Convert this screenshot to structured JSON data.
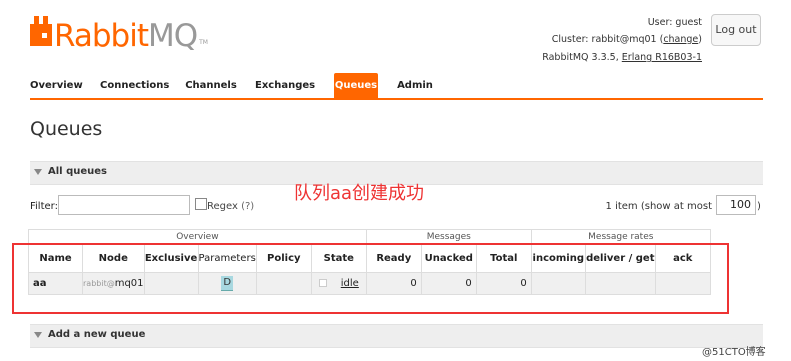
{
  "header": {
    "logo_left": "Rabbit",
    "logo_right": "MQ",
    "logo_tm": "TM",
    "user_label": "User:",
    "user_value": "guest",
    "cluster_label": "Cluster:",
    "cluster_value": "rabbit@mq01",
    "change_link": "change",
    "version_text": "RabbitMQ 3.3.5,",
    "erlang_text": "Erlang R16B03-1",
    "logout_label": "Log out"
  },
  "tabs": [
    {
      "label": "Overview",
      "active": false
    },
    {
      "label": "Connections",
      "active": false
    },
    {
      "label": "Channels",
      "active": false
    },
    {
      "label": "Exchanges",
      "active": false
    },
    {
      "label": "Queues",
      "active": true
    },
    {
      "label": "Admin",
      "active": false
    }
  ],
  "page_title": "Queues",
  "all_queues": {
    "section_label": "All queues",
    "filter_label": "Filter:",
    "filter_value": "",
    "regex_label": "Regex",
    "regex_help": "(?)",
    "items_text": "1 item (show at most",
    "max_value": "100",
    "max_close": ")",
    "annotation_cn": "队列aa创建成功",
    "group_headers": {
      "overview": "Overview",
      "messages": "Messages",
      "message_rates": "Message rates"
    },
    "columns": {
      "name": "Name",
      "node": "Node",
      "exclusive": "Exclusive",
      "parameters": "Parameters",
      "policy": "Policy",
      "state": "State",
      "ready": "Ready",
      "unacked": "Unacked",
      "total": "Total",
      "incoming": "incoming",
      "deliver_get": "deliver / get",
      "ack": "ack"
    },
    "rows": [
      {
        "name": "aa",
        "node_prefix": "rabbit@",
        "node_host": "mq01",
        "exclusive": "",
        "parameters": "D",
        "policy": "",
        "state": "idle",
        "ready": "0",
        "unacked": "0",
        "total": "0",
        "incoming": "",
        "deliver_get": "",
        "ack": ""
      }
    ]
  },
  "add_queue": {
    "section_label": "Add a new queue"
  },
  "watermark": "@51CTO博客",
  "colors": {
    "accent": "#ff6600",
    "annotation": "#ee3333"
  }
}
